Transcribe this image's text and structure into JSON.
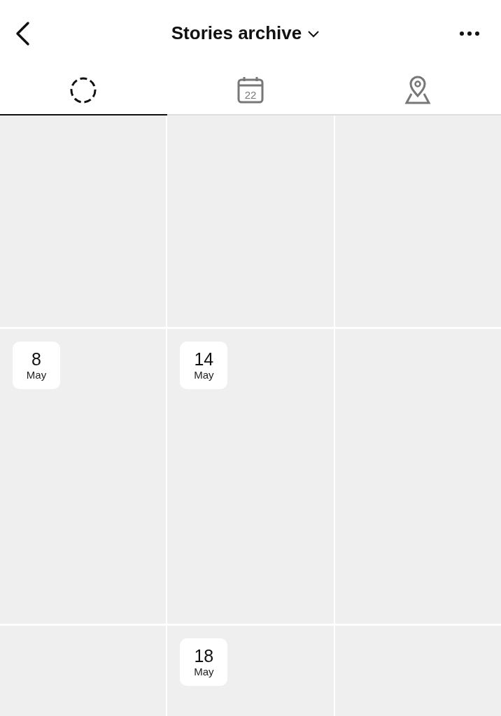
{
  "header": {
    "title": "Stories archive"
  },
  "tabs": [
    {
      "kind": "archive",
      "selected": true
    },
    {
      "kind": "calendar",
      "icon_text": "22",
      "selected": false
    },
    {
      "kind": "map",
      "selected": false
    }
  ],
  "grid": {
    "rows": [
      {
        "kind": "partial",
        "tiles": [
          {
            "kind": "blank"
          },
          {
            "kind": "blank"
          },
          {
            "kind": "blank"
          }
        ]
      },
      {
        "kind": "full",
        "tiles": [
          {
            "kind": "dated",
            "day": "8",
            "month": "May"
          },
          {
            "kind": "dated",
            "day": "14",
            "month": "May"
          },
          {
            "kind": "blank"
          }
        ]
      },
      {
        "kind": "partial",
        "tiles": [
          {
            "kind": "blank"
          },
          {
            "kind": "dated",
            "day": "18",
            "month": "May"
          },
          {
            "kind": "blank"
          }
        ]
      }
    ]
  }
}
